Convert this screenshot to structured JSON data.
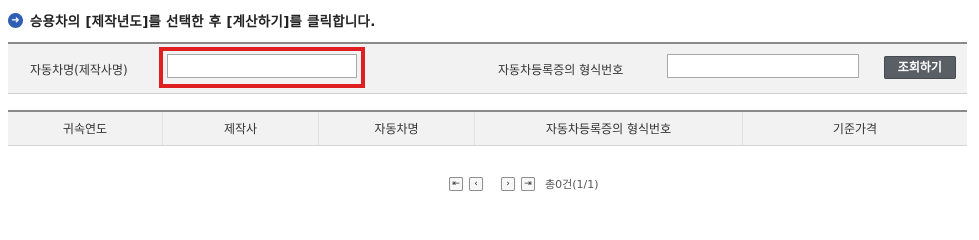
{
  "instruction": {
    "bullet_icon": "➜",
    "text": "승용차의 [제작년도]를 선택한 후 [계산하기]를 클릭합니다."
  },
  "search": {
    "car_label": "자동차명(제작사명)",
    "car_value": "",
    "type_label": "자동차등록증의 형식번호",
    "type_value": "",
    "button_label": "조회하기",
    "highlight_color": "#e02020"
  },
  "table": {
    "headers": [
      "귀속연도",
      "제작사",
      "자동차명",
      "자동차등록증의 형식번호",
      "기준가격"
    ]
  },
  "pagination": {
    "first_icon": "⇤",
    "prev_icon": "‹",
    "next_icon": "›",
    "last_icon": "⇥",
    "summary": "총0건(1/1)"
  }
}
